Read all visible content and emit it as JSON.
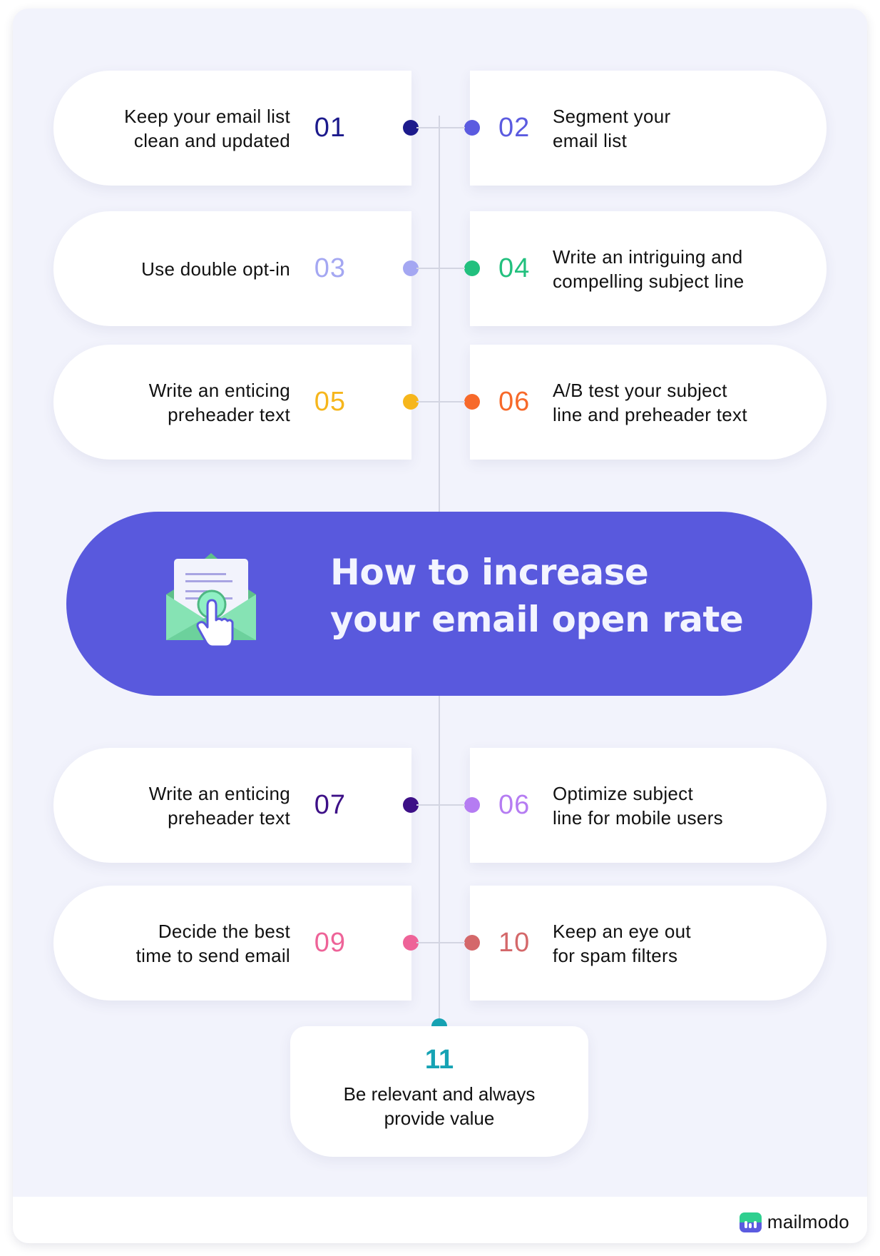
{
  "title": {
    "line1": "How to increase",
    "line2": "your email open rate"
  },
  "items": [
    {
      "num": "01",
      "side": "left",
      "line1": "Keep your email list",
      "line2": "clean and updated",
      "color": "#1c1a8c"
    },
    {
      "num": "02",
      "side": "right",
      "line1": "Segment your",
      "line2": "email list",
      "color": "#5b5be0"
    },
    {
      "num": "03",
      "side": "left",
      "line1": "Use double opt-in",
      "line2": "",
      "color": "#a4a7f2"
    },
    {
      "num": "04",
      "side": "right",
      "line1": "Write an intriguing and",
      "line2": "compelling subject line",
      "color": "#22c07e"
    },
    {
      "num": "05",
      "side": "left",
      "line1": "Write an enticing",
      "line2": "preheader text",
      "color": "#f6b61c"
    },
    {
      "num": "06",
      "side": "right",
      "line1": "A/B test your subject",
      "line2": "line and preheader text",
      "color": "#f7692a"
    },
    {
      "num": "07",
      "side": "left",
      "line1": "Write an enticing",
      "line2": "preheader text",
      "color": "#3d1087"
    },
    {
      "num": "06",
      "side": "right",
      "line1": "Optimize subject",
      "line2": "line for mobile users",
      "color": "#b57cf2"
    },
    {
      "num": "09",
      "side": "left",
      "line1": "Decide the best",
      "line2": "time to send email",
      "color": "#ee6398"
    },
    {
      "num": "10",
      "side": "right",
      "line1": "Keep an eye out",
      "line2": "for spam filters",
      "color": "#d4686a"
    }
  ],
  "final_item": {
    "num": "11",
    "line1": "Be relevant and always",
    "line2": "provide value",
    "color": "#16a3b4"
  },
  "brand": {
    "name": "mailmodo",
    "icon": "mailmodo-logo-icon"
  },
  "hero_icon": "envelope-click-icon",
  "colors": {
    "banner": "#5959dd",
    "background": "#f2f3fc",
    "connector": "#d3d5e2"
  }
}
